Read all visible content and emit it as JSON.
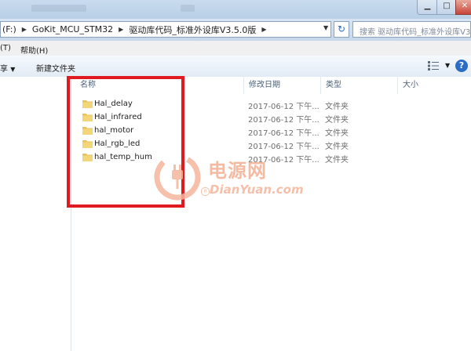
{
  "address_bar": {
    "crumbs": [
      "(F:)",
      "GoKit_MCU_STM32",
      "驱动库代码_标准外设库V3.5.0版"
    ],
    "search_placeholder": "搜索 驱动库代码_标准外设库V3.5.0版"
  },
  "menubar": {
    "items": [
      "(T)",
      "帮助(H)"
    ]
  },
  "toolbar": {
    "organize_partial": "享",
    "new_folder": "新建文件夹"
  },
  "columns": {
    "name": "名称",
    "modified": "修改日期",
    "type": "类型",
    "size": "大小"
  },
  "files": [
    {
      "name": "Hal_delay",
      "modified": "2017-06-12 下午...",
      "type": "文件夹"
    },
    {
      "name": "Hal_infrared",
      "modified": "2017-06-12 下午...",
      "type": "文件夹"
    },
    {
      "name": "hal_motor",
      "modified": "2017-06-12 下午...",
      "type": "文件夹"
    },
    {
      "name": "Hal_rgb_led",
      "modified": "2017-06-12 下午...",
      "type": "文件夹"
    },
    {
      "name": "hal_temp_hum",
      "modified": "2017-06-12 下午...",
      "type": "文件夹"
    }
  ],
  "watermark": {
    "cn": "电源网",
    "en": "DianYuan.com"
  },
  "colors": {
    "annotation_red": "#e11a22",
    "watermark_orange": "#f2aa8c",
    "folder_yellow": "#e8c25a"
  },
  "icons": [
    "minimize-icon",
    "maximize-icon",
    "close-icon",
    "refresh-icon",
    "dropdown-icon",
    "view-icon",
    "help-icon",
    "folder-icon"
  ]
}
